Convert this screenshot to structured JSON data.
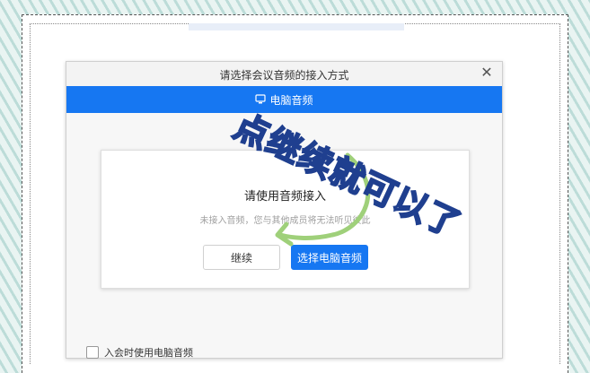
{
  "dialog": {
    "title": "请选择会议音频的接入方式",
    "close_icon": "close-icon",
    "tab_label": "电脑音频",
    "tab_icon": "computer-audio-icon"
  },
  "card": {
    "title": "请使用音频接入",
    "description": "未接入音频，您与其他成员将无法听见彼此",
    "continue_label": "继续",
    "select_label": "选择电脑音频"
  },
  "auto_join": {
    "label": "入会时使用电脑音频",
    "checked": false
  },
  "annotation": {
    "text": "点继续就可以了",
    "arrow": "curved-arrow"
  },
  "colors": {
    "accent": "#1677f2",
    "annotation_stroke": "#1f3f8f",
    "annotation_arrow": "#9fd07a"
  }
}
